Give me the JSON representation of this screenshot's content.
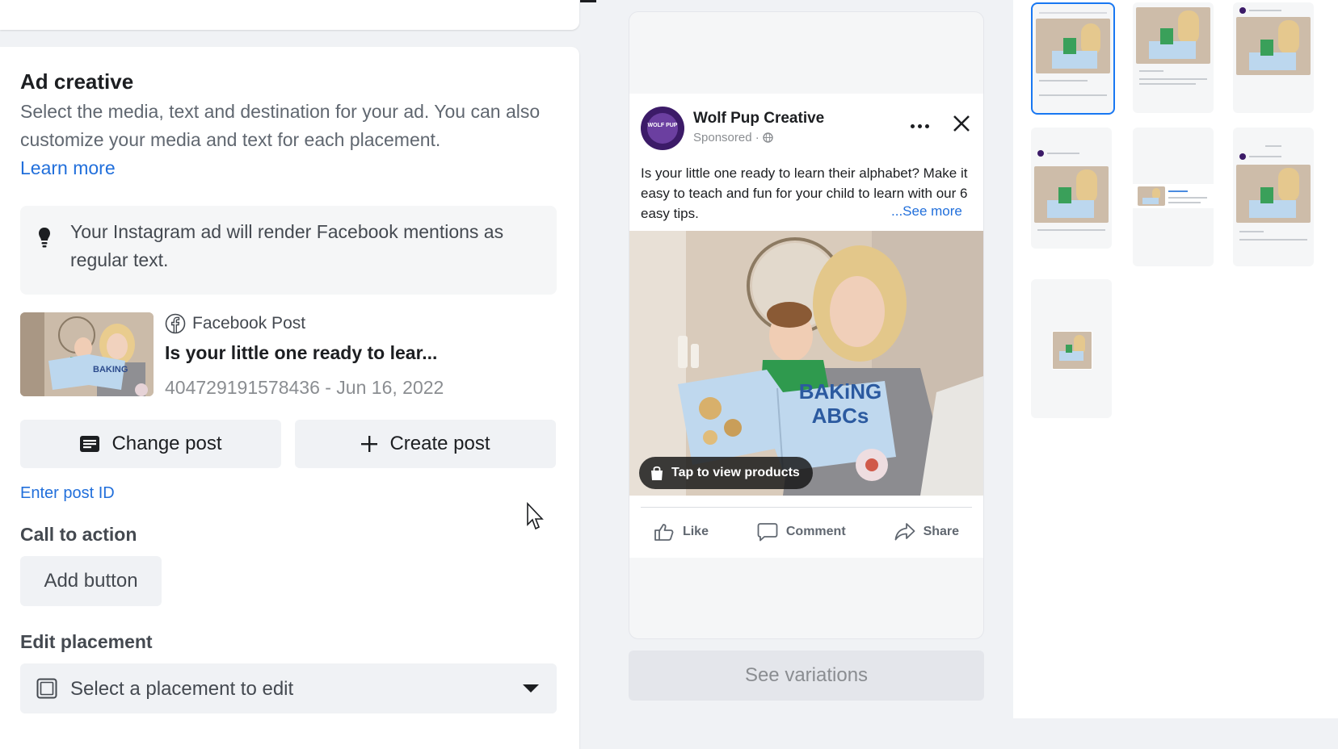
{
  "ad_creative": {
    "title": "Ad creative",
    "description": "Select the media, text and destination for your ad. You can also customize your media and text for each placement.",
    "learn_more": "Learn more",
    "info": "Your Instagram ad will render Facebook mentions as regular text.",
    "post": {
      "source": "Facebook Post",
      "title": "Is your little one ready to lear...",
      "meta": "404729191578436 - Jun 16, 2022"
    },
    "change_post": "Change post",
    "create_post": "Create post",
    "enter_post_id": "Enter post ID",
    "cta_label": "Call to action",
    "add_button": "Add button",
    "edit_placement_label": "Edit placement",
    "placement_select": "Select a placement to edit"
  },
  "preview": {
    "page_name": "Wolf Pup Creative",
    "sponsored": "Sponsored ·",
    "avatar_text": "WOLF PUP",
    "body": "Is your little one ready to learn their alphabet? Make it easy to teach and fun for your child to learn with our 6 easy tips.",
    "see_more": "...See more",
    "book_title": "BAKiNG ABCs",
    "tap_products": "Tap to view products",
    "actions": {
      "like": "Like",
      "comment": "Comment",
      "share": "Share"
    },
    "see_variations": "See variations"
  },
  "colors": {
    "link": "#216fdb",
    "selected_border": "#1877f2"
  }
}
